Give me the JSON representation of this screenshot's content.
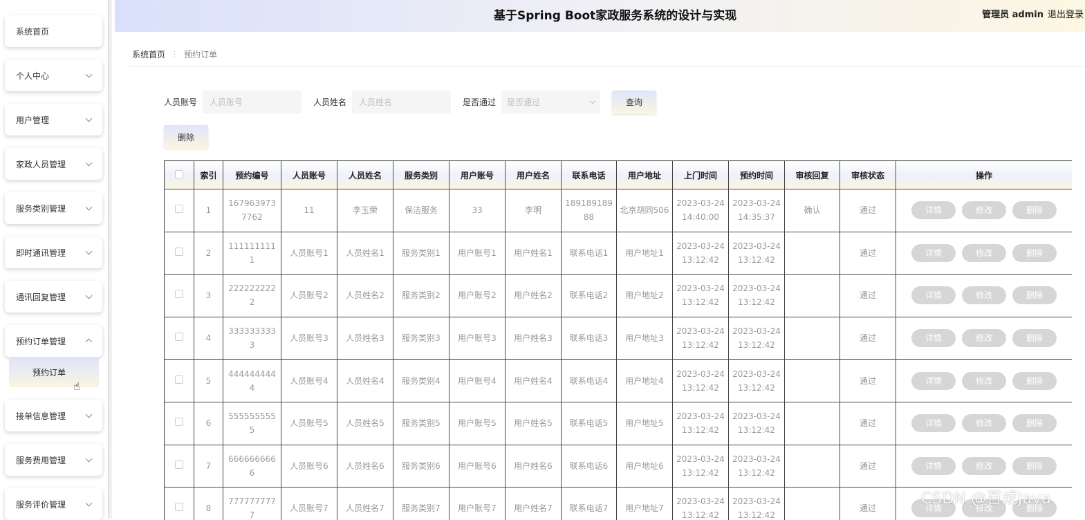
{
  "header": {
    "title": "基于Spring Boot家政服务系统的设计与实现",
    "user": "管理员 admin",
    "logout": "退出登录"
  },
  "sidebar": {
    "items": [
      {
        "label": "系统首页",
        "chevron": false
      },
      {
        "label": "个人中心",
        "chevron": true
      },
      {
        "label": "用户管理",
        "chevron": true
      },
      {
        "label": "家政人员管理",
        "chevron": true
      },
      {
        "label": "服务类别管理",
        "chevron": true
      },
      {
        "label": "即时通讯管理",
        "chevron": true
      },
      {
        "label": "通讯回复管理",
        "chevron": true
      },
      {
        "label": "预约订单管理",
        "chevron": true,
        "expanded": true
      },
      {
        "label": "接单信息管理",
        "chevron": true
      },
      {
        "label": "服务费用管理",
        "chevron": true
      },
      {
        "label": "服务评价管理",
        "chevron": true
      }
    ],
    "submenu": {
      "label": "预约订单"
    }
  },
  "breadcrumb": {
    "home": "系统首页",
    "separator": "⋮",
    "current": "预约订单"
  },
  "search": {
    "account_label": "人员账号",
    "account_placeholder": "人员账号",
    "name_label": "人员姓名",
    "name_placeholder": "人员姓名",
    "pass_label": "是否通过",
    "pass_placeholder": "是否通过",
    "query_button": "查询"
  },
  "toolbar": {
    "delete_button": "删除"
  },
  "table": {
    "columns": [
      "",
      "索引",
      "预约编号",
      "人员账号",
      "人员姓名",
      "服务类别",
      "用户账号",
      "用户姓名",
      "联系电话",
      "用户地址",
      "上门时间",
      "预约时间",
      "审核回复",
      "审核状态",
      "操作"
    ],
    "rows": [
      [
        "1",
        "1679639737762",
        "11",
        "李玉荣",
        "保洁服务",
        "33",
        "李明",
        "18918918988",
        "北京胡同506",
        "2023-03-24 14:40:00",
        "2023-03-24 14:35:37",
        "确认",
        "通过"
      ],
      [
        "2",
        "1111111111",
        "人员账号1",
        "人员姓名1",
        "服务类别1",
        "用户账号1",
        "用户姓名1",
        "联系电话1",
        "用户地址1",
        "2023-03-24 13:12:42",
        "2023-03-24 13:12:42",
        "",
        "通过"
      ],
      [
        "3",
        "2222222222",
        "人员账号2",
        "人员姓名2",
        "服务类别2",
        "用户账号2",
        "用户姓名2",
        "联系电话2",
        "用户地址2",
        "2023-03-24 13:12:42",
        "2023-03-24 13:12:42",
        "",
        "通过"
      ],
      [
        "4",
        "3333333333",
        "人员账号3",
        "人员姓名3",
        "服务类别3",
        "用户账号3",
        "用户姓名3",
        "联系电话3",
        "用户地址3",
        "2023-03-24 13:12:42",
        "2023-03-24 13:12:42",
        "",
        "通过"
      ],
      [
        "5",
        "4444444444",
        "人员账号4",
        "人员姓名4",
        "服务类别4",
        "用户账号4",
        "用户姓名4",
        "联系电话4",
        "用户地址4",
        "2023-03-24 13:12:42",
        "2023-03-24 13:12:42",
        "",
        "通过"
      ],
      [
        "6",
        "5555555555",
        "人员账号5",
        "人员姓名5",
        "服务类别5",
        "用户账号5",
        "用户姓名5",
        "联系电话5",
        "用户地址5",
        "2023-03-24 13:12:42",
        "2023-03-24 13:12:42",
        "",
        "通过"
      ],
      [
        "7",
        "6666666666",
        "人员账号6",
        "人员姓名6",
        "服务类别6",
        "用户账号6",
        "用户姓名6",
        "联系电话6",
        "用户地址6",
        "2023-03-24 13:12:42",
        "2023-03-24 13:12:42",
        "",
        "通过"
      ],
      [
        "8",
        "7777777777",
        "人员账号7",
        "人员姓名7",
        "服务类别7",
        "用户账号7",
        "用户姓名7",
        "联系电话7",
        "用户地址7",
        "2023-03-24 13:12:42",
        "2023-03-24 13:12:42",
        "",
        "通过"
      ]
    ],
    "actions": [
      "详情",
      "修改",
      "删除"
    ]
  },
  "watermark": "CSDN @百成Java"
}
